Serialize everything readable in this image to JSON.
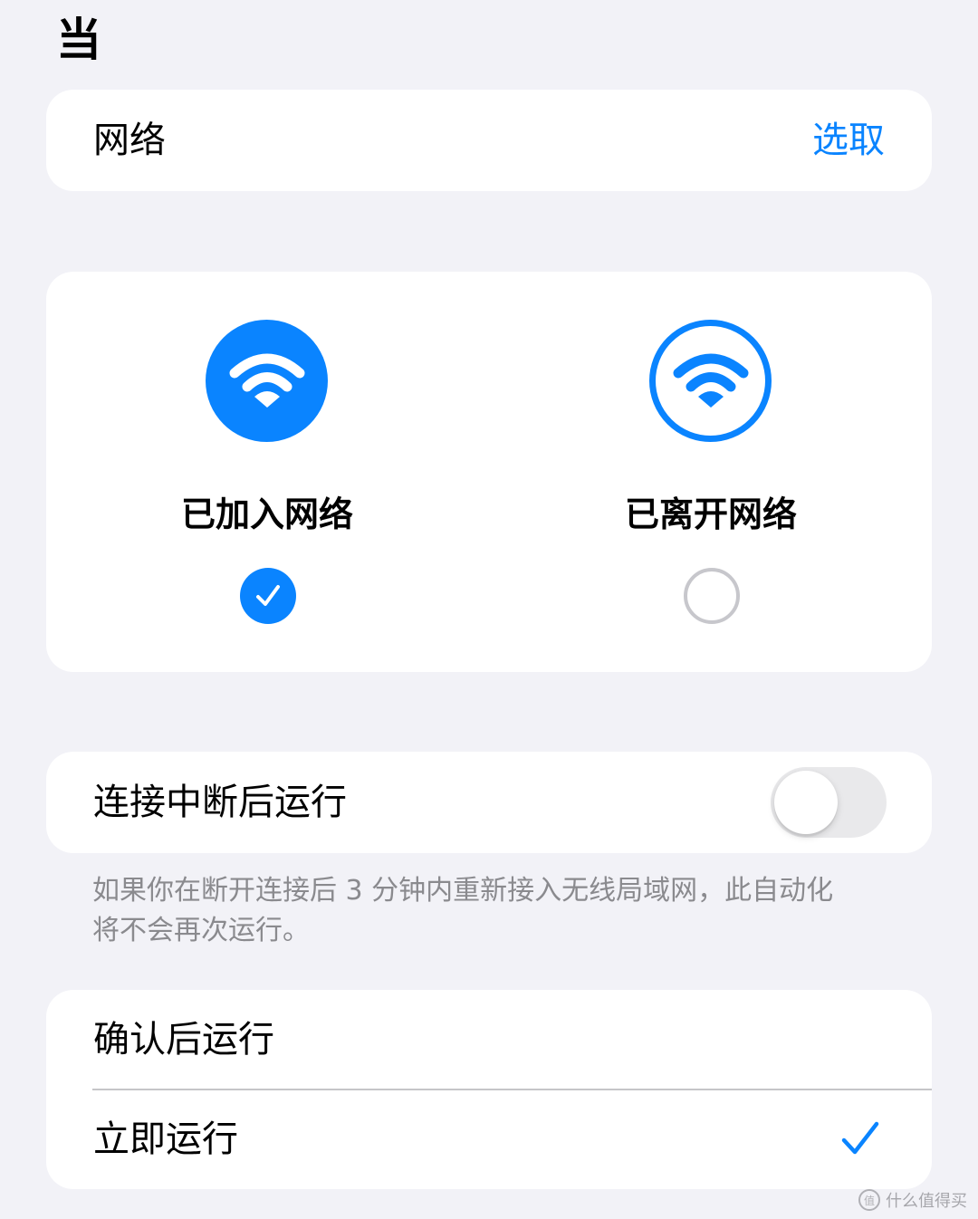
{
  "section": {
    "heading": "当"
  },
  "network": {
    "label": "网络",
    "action": "选取"
  },
  "trigger": {
    "options": [
      {
        "label": "已加入网络",
        "selected": true
      },
      {
        "label": "已离开网络",
        "selected": false
      }
    ]
  },
  "reconnect": {
    "label": "连接中断后运行",
    "enabled": false
  },
  "footnote": "如果你在断开连接后 3 分钟内重新接入无线局域网，此自动化将不会再次运行。",
  "run_mode": {
    "items": [
      {
        "label": "确认后运行",
        "selected": false
      },
      {
        "label": "立即运行",
        "selected": true
      }
    ]
  },
  "watermark": {
    "text": "什么值得买",
    "logo_glyph": "值"
  },
  "colors": {
    "accent": "#0a84ff",
    "background": "#f2f2f7",
    "card": "#ffffff",
    "secondary_text": "#8a8a8e"
  },
  "icons": {
    "wifi": "wifi-icon",
    "check": "checkmark-icon"
  }
}
